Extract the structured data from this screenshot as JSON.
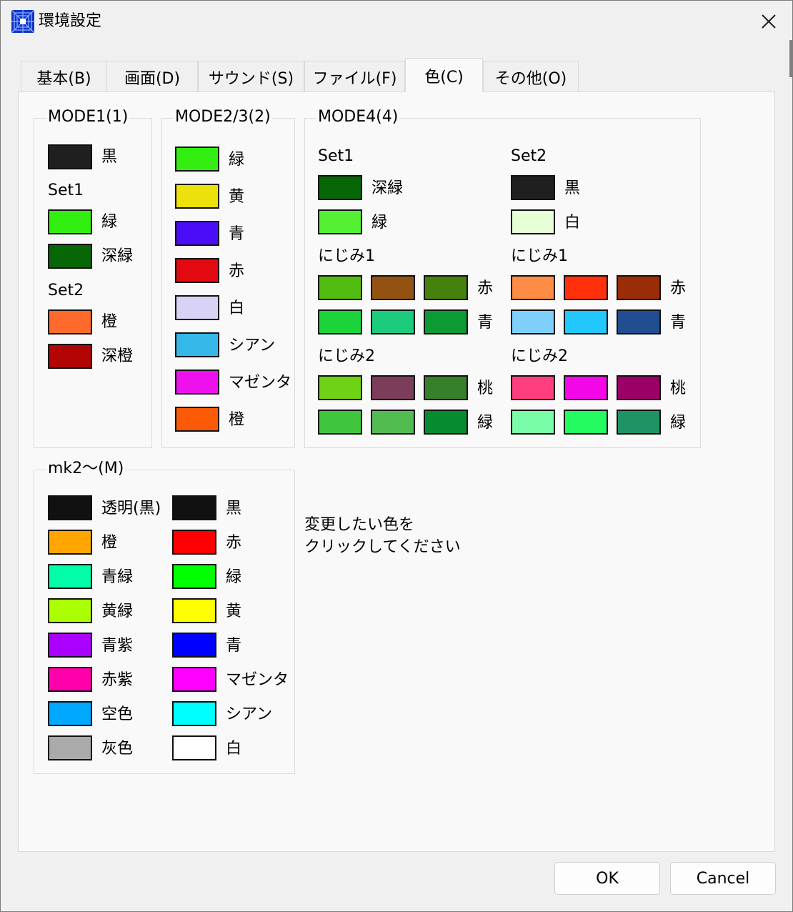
{
  "window": {
    "title": "環境設定"
  },
  "tabs": [
    {
      "label": "基本(B)"
    },
    {
      "label": "画面(D)"
    },
    {
      "label": "サウンド(S)"
    },
    {
      "label": "ファイル(F)"
    },
    {
      "label": "色(C)",
      "active": true
    },
    {
      "label": "その他(O)"
    }
  ],
  "mode1": {
    "label": "MODE1(1)",
    "top": {
      "color": "#1f1f1f",
      "label": "黒"
    },
    "set1": {
      "label": "Set1",
      "items": [
        {
          "color": "#33ee11",
          "label": "緑"
        },
        {
          "color": "#076707",
          "label": "深緑"
        }
      ]
    },
    "set2": {
      "label": "Set2",
      "items": [
        {
          "color": "#fd6a2b",
          "label": "橙"
        },
        {
          "color": "#b20505",
          "label": "深橙"
        }
      ]
    }
  },
  "mode23": {
    "label": "MODE2/3(2)",
    "items": [
      {
        "color": "#33ee11",
        "label": "緑"
      },
      {
        "color": "#ede10b",
        "label": "黄"
      },
      {
        "color": "#4b0cf8",
        "label": "青"
      },
      {
        "color": "#e20a10",
        "label": "赤"
      },
      {
        "color": "#d8d2f4",
        "label": "白"
      },
      {
        "color": "#35b8e8",
        "label": "シアン"
      },
      {
        "color": "#ee11ee",
        "label": "マゼンタ"
      },
      {
        "color": "#fd5a08",
        "label": "橙"
      }
    ]
  },
  "mode4": {
    "label": "MODE4(4)",
    "set1": {
      "label": "Set1",
      "items": [
        {
          "color": "#076707",
          "label": "深緑"
        },
        {
          "color": "#55ef33",
          "label": "緑"
        }
      ],
      "nijimi1": {
        "label": "にじみ1",
        "rows": [
          {
            "colors": [
              "#52bd11",
              "#935212",
              "#46810d"
            ],
            "label": "赤"
          },
          {
            "colors": [
              "#1bd43a",
              "#1dcb7d",
              "#0c9b33"
            ],
            "label": "青"
          }
        ]
      },
      "nijimi2": {
        "label": "にじみ2",
        "rows": [
          {
            "colors": [
              "#6ed315",
              "#7c3d5a",
              "#358029"
            ],
            "label": "桃"
          },
          {
            "colors": [
              "#40c63d",
              "#53bc50",
              "#078b2f"
            ],
            "label": "緑"
          }
        ]
      }
    },
    "set2": {
      "label": "Set2",
      "items": [
        {
          "color": "#1f1f1f",
          "label": "黒"
        },
        {
          "color": "#e6ffd7",
          "label": "白"
        }
      ],
      "nijimi1": {
        "label": "にじみ1",
        "rows": [
          {
            "colors": [
              "#ff8c45",
              "#ff300a",
              "#992d07"
            ],
            "label": "赤"
          },
          {
            "colors": [
              "#7fcffc",
              "#21c7fd",
              "#204e91"
            ],
            "label": "青"
          }
        ]
      },
      "nijimi2": {
        "label": "にじみ2",
        "rows": [
          {
            "colors": [
              "#ff3e7f",
              "#f307e8",
              "#9b0067"
            ],
            "label": "桃"
          },
          {
            "colors": [
              "#7afda8",
              "#24fb61",
              "#1f9363"
            ],
            "label": "緑"
          }
        ]
      }
    }
  },
  "mk2": {
    "label": "mk2～(M)",
    "col1": [
      {
        "color": "#111111",
        "label": "透明(黒)"
      },
      {
        "color": "#ffa700",
        "label": "橙"
      },
      {
        "color": "#00feaa",
        "label": "青緑"
      },
      {
        "color": "#aaff00",
        "label": "黄緑"
      },
      {
        "color": "#aa00ff",
        "label": "青紫"
      },
      {
        "color": "#ff00aa",
        "label": "赤紫"
      },
      {
        "color": "#00a8ff",
        "label": "空色"
      },
      {
        "color": "#aaaaaa",
        "label": "灰色"
      }
    ],
    "col2": [
      {
        "color": "#111111",
        "label": "黒"
      },
      {
        "color": "#ff0000",
        "label": "赤"
      },
      {
        "color": "#00ff00",
        "label": "緑"
      },
      {
        "color": "#ffff00",
        "label": "黄"
      },
      {
        "color": "#0000ff",
        "label": "青"
      },
      {
        "color": "#ff00ff",
        "label": "マゼンタ"
      },
      {
        "color": "#00ffff",
        "label": "シアン"
      },
      {
        "color": "#ffffff",
        "label": "白"
      }
    ]
  },
  "hint": {
    "line1": "変更したい色を",
    "line2": "クリックしてください"
  },
  "buttons": {
    "ok": "OK",
    "cancel": "Cancel"
  }
}
